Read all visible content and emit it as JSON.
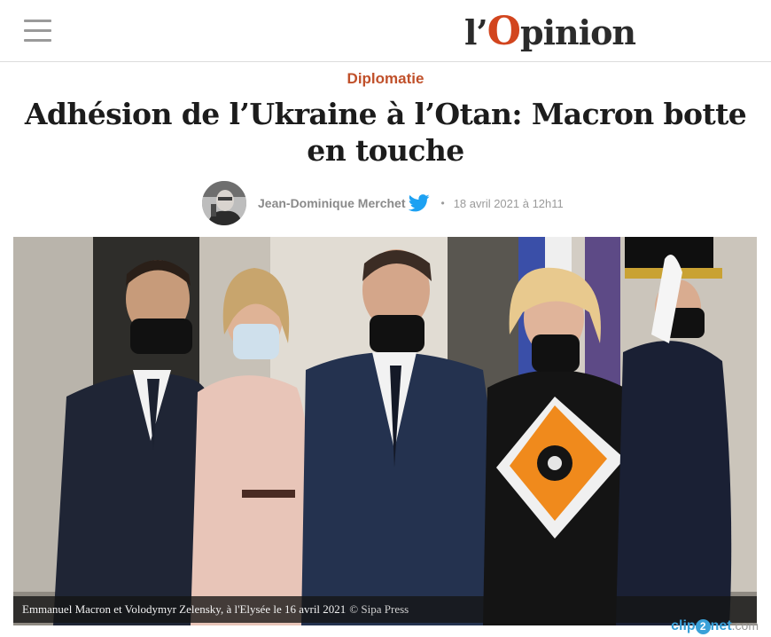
{
  "header": {
    "menu_icon": "hamburger-menu-icon",
    "logo_prefix": "l’",
    "logo_o": "O",
    "logo_suffix": "pinion",
    "logo_accent": "#d2451e"
  },
  "article": {
    "category": "Diplomatie",
    "title": "Adhésion de l’Ukraine à l’Otan: Macron botte en touche",
    "author": "Jean-Dominique Merchet",
    "author_social_icon": "twitter-icon",
    "separator": "•",
    "date": "18 avril 2021 à 12h11",
    "photo_caption": "Emmanuel Macron et Volodymyr Zelensky, à l'Elysée le 16 avril 2021",
    "photo_credit": "© Sipa Press"
  },
  "watermark": {
    "part1": "clip",
    "part2": "2",
    "part3": "net",
    "part4": ".com"
  },
  "colors": {
    "category": "#c0502a",
    "twitter": "#1da1f2",
    "watermark": "#3aa1d8"
  }
}
